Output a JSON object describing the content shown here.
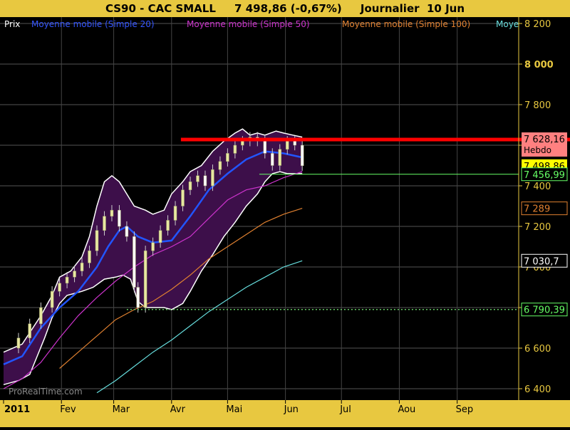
{
  "header": {
    "symbol": "CS90 - CAC SMALL",
    "price_change": "7 498,86 (-0,67%)",
    "period": "Journalier  10 Jun"
  },
  "legend": [
    {
      "label": "Prix",
      "color": "#ffffff"
    },
    {
      "label": "Moyenne mobile (Simple 20)",
      "color": "#3355ff"
    },
    {
      "label": "Moyenne mobile (Simple 50)",
      "color": "#cc33cc"
    },
    {
      "label": "Moyenne mobile (Simple 100)",
      "color": "#e08030"
    },
    {
      "label": "Moye",
      "color": "#66dddd"
    }
  ],
  "watermark": "ProRealTime.com",
  "colors": {
    "header_bg": "#e8c840",
    "band_fill": "#3d0f4a",
    "candle_up": "#e8e8a0",
    "candle_down": "#ffffff",
    "resistance": "#ff0000",
    "support_line": "#66ff66",
    "support_dotted": "#66cc66"
  },
  "price_labels": [
    {
      "text": "7 628,16",
      "sub": "Hebdo",
      "bg": "#ff8080",
      "fg": "#000000",
      "value": 7628.16
    },
    {
      "text": "7 498,86",
      "bg": "#ffff00",
      "fg": "#000000",
      "value": 7498.86
    },
    {
      "text": "7 456,99",
      "bg": "#000000",
      "fg": "#66ff66",
      "value": 7456.99
    },
    {
      "text": "7 289",
      "bg": "#000000",
      "fg": "#e08030",
      "value": 7289
    },
    {
      "text": "7 030,7",
      "bg": "#000000",
      "fg": "#ffffff",
      "value": 7030.7
    },
    {
      "text": "6 790,39",
      "bg": "#000000",
      "fg": "#66ff66",
      "value": 6790.39
    }
  ],
  "chart_data": {
    "type": "line",
    "title": "CS90 - CAC SMALL",
    "y_ticks": [
      {
        "value": 8200,
        "label": "8 200"
      },
      {
        "value": 8000,
        "label": "8 000"
      },
      {
        "value": 7800,
        "label": "7 800"
      },
      {
        "value": 7600,
        "label": "7 600"
      },
      {
        "value": 7400,
        "label": "7 400"
      },
      {
        "value": 7200,
        "label": "7 200"
      },
      {
        "value": 7000,
        "label": "7 000"
      },
      {
        "value": 6800,
        "label": "6 800"
      },
      {
        "value": 6600,
        "label": "6 600"
      },
      {
        "value": 6400,
        "label": "6 400"
      }
    ],
    "x_ticks": [
      {
        "day": 0,
        "label": "2011"
      },
      {
        "day": 31,
        "label": "Fev"
      },
      {
        "day": 59,
        "label": "Mar"
      },
      {
        "day": 90,
        "label": "Avr"
      },
      {
        "day": 120,
        "label": "Mai"
      },
      {
        "day": 151,
        "label": "Jun"
      },
      {
        "day": 181,
        "label": "Jul"
      },
      {
        "day": 212,
        "label": "Aou"
      },
      {
        "day": 243,
        "label": "Sep"
      }
    ],
    "ylim": [
      6350,
      8250
    ],
    "xlim": [
      0,
      270
    ],
    "grid": true,
    "close": [
      [
        2,
        6600
      ],
      [
        8,
        6650
      ],
      [
        14,
        6720
      ],
      [
        20,
        6800
      ],
      [
        26,
        6880
      ],
      [
        30,
        6920
      ],
      [
        34,
        6950
      ],
      [
        38,
        6980
      ],
      [
        42,
        7020
      ],
      [
        46,
        7080
      ],
      [
        50,
        7180
      ],
      [
        54,
        7250
      ],
      [
        58,
        7280
      ],
      [
        62,
        7200
      ],
      [
        66,
        7150
      ],
      [
        70,
        6900
      ],
      [
        72,
        6800
      ],
      [
        76,
        7080
      ],
      [
        80,
        7120
      ],
      [
        84,
        7180
      ],
      [
        88,
        7230
      ],
      [
        92,
        7300
      ],
      [
        96,
        7380
      ],
      [
        100,
        7420
      ],
      [
        104,
        7450
      ],
      [
        108,
        7400
      ],
      [
        112,
        7480
      ],
      [
        116,
        7520
      ],
      [
        120,
        7560
      ],
      [
        124,
        7600
      ],
      [
        128,
        7620
      ],
      [
        132,
        7640
      ],
      [
        136,
        7620
      ],
      [
        140,
        7560
      ],
      [
        144,
        7500
      ],
      [
        148,
        7580
      ],
      [
        152,
        7620
      ],
      [
        156,
        7600
      ],
      [
        160,
        7498.86
      ]
    ],
    "series": [
      {
        "name": "Moyenne mobile (Simple 20)",
        "color": "#2255ff",
        "points": [
          [
            0,
            6520
          ],
          [
            10,
            6560
          ],
          [
            20,
            6700
          ],
          [
            30,
            6800
          ],
          [
            40,
            6880
          ],
          [
            50,
            7000
          ],
          [
            56,
            7100
          ],
          [
            62,
            7180
          ],
          [
            66,
            7200
          ],
          [
            72,
            7150
          ],
          [
            80,
            7120
          ],
          [
            90,
            7130
          ],
          [
            100,
            7250
          ],
          [
            110,
            7380
          ],
          [
            120,
            7460
          ],
          [
            130,
            7530
          ],
          [
            140,
            7570
          ],
          [
            150,
            7560
          ],
          [
            160,
            7540
          ]
        ]
      },
      {
        "name": "Moyenne mobile (Simple 50)",
        "color": "#cc33cc",
        "points": [
          [
            0,
            6400
          ],
          [
            10,
            6450
          ],
          [
            20,
            6530
          ],
          [
            30,
            6650
          ],
          [
            40,
            6760
          ],
          [
            50,
            6850
          ],
          [
            60,
            6930
          ],
          [
            70,
            7000
          ],
          [
            80,
            7060
          ],
          [
            90,
            7100
          ],
          [
            100,
            7150
          ],
          [
            110,
            7240
          ],
          [
            120,
            7330
          ],
          [
            130,
            7380
          ],
          [
            140,
            7400
          ],
          [
            150,
            7440
          ],
          [
            160,
            7470
          ]
        ]
      },
      {
        "name": "Moyenne mobile (Simple 100)",
        "color": "#e08030",
        "points": [
          [
            30,
            6500
          ],
          [
            40,
            6580
          ],
          [
            50,
            6660
          ],
          [
            60,
            6740
          ],
          [
            70,
            6790
          ],
          [
            80,
            6830
          ],
          [
            90,
            6890
          ],
          [
            100,
            6960
          ],
          [
            110,
            7040
          ],
          [
            120,
            7100
          ],
          [
            130,
            7160
          ],
          [
            140,
            7220
          ],
          [
            150,
            7260
          ],
          [
            160,
            7289
          ]
        ]
      },
      {
        "name": "Moye",
        "color": "#66dddd",
        "points": [
          [
            50,
            6380
          ],
          [
            60,
            6440
          ],
          [
            70,
            6510
          ],
          [
            80,
            6580
          ],
          [
            90,
            6640
          ],
          [
            100,
            6710
          ],
          [
            110,
            6780
          ],
          [
            120,
            6840
          ],
          [
            130,
            6900
          ],
          [
            140,
            6950
          ],
          [
            150,
            7000
          ],
          [
            160,
            7030.7
          ]
        ]
      }
    ],
    "bollinger_upper": [
      [
        0,
        6580
      ],
      [
        10,
        6620
      ],
      [
        20,
        6760
      ],
      [
        26,
        6860
      ],
      [
        30,
        6950
      ],
      [
        36,
        6980
      ],
      [
        42,
        7050
      ],
      [
        46,
        7150
      ],
      [
        50,
        7300
      ],
      [
        54,
        7420
      ],
      [
        58,
        7450
      ],
      [
        62,
        7420
      ],
      [
        66,
        7360
      ],
      [
        70,
        7300
      ],
      [
        76,
        7280
      ],
      [
        80,
        7260
      ],
      [
        86,
        7280
      ],
      [
        90,
        7360
      ],
      [
        96,
        7420
      ],
      [
        100,
        7470
      ],
      [
        106,
        7500
      ],
      [
        112,
        7570
      ],
      [
        118,
        7620
      ],
      [
        124,
        7660
      ],
      [
        128,
        7680
      ],
      [
        132,
        7650
      ],
      [
        136,
        7660
      ],
      [
        140,
        7650
      ],
      [
        146,
        7670
      ],
      [
        150,
        7660
      ],
      [
        155,
        7650
      ],
      [
        160,
        7640
      ]
    ],
    "bollinger_lower": [
      [
        0,
        6420
      ],
      [
        8,
        6440
      ],
      [
        14,
        6470
      ],
      [
        18,
        6560
      ],
      [
        22,
        6650
      ],
      [
        26,
        6750
      ],
      [
        30,
        6820
      ],
      [
        34,
        6860
      ],
      [
        38,
        6870
      ],
      [
        42,
        6880
      ],
      [
        48,
        6900
      ],
      [
        54,
        6940
      ],
      [
        60,
        6950
      ],
      [
        64,
        6960
      ],
      [
        68,
        6940
      ],
      [
        72,
        6830
      ],
      [
        76,
        6800
      ],
      [
        80,
        6800
      ],
      [
        86,
        6800
      ],
      [
        90,
        6790
      ],
      [
        96,
        6820
      ],
      [
        100,
        6880
      ],
      [
        106,
        6980
      ],
      [
        112,
        7060
      ],
      [
        118,
        7150
      ],
      [
        124,
        7220
      ],
      [
        130,
        7300
      ],
      [
        136,
        7360
      ],
      [
        140,
        7420
      ],
      [
        144,
        7460
      ],
      [
        148,
        7470
      ],
      [
        152,
        7460
      ],
      [
        160,
        7460
      ]
    ],
    "levels": [
      {
        "value": 7628.16,
        "label": "7 628,16",
        "style": "resistance",
        "from_day": 95
      },
      {
        "value": 7456.99,
        "label": "7 456,99",
        "style": "support",
        "from_day": 137
      },
      {
        "value": 6790.39,
        "label": "6 790,39",
        "style": "dotted",
        "from_day": 66
      }
    ]
  }
}
